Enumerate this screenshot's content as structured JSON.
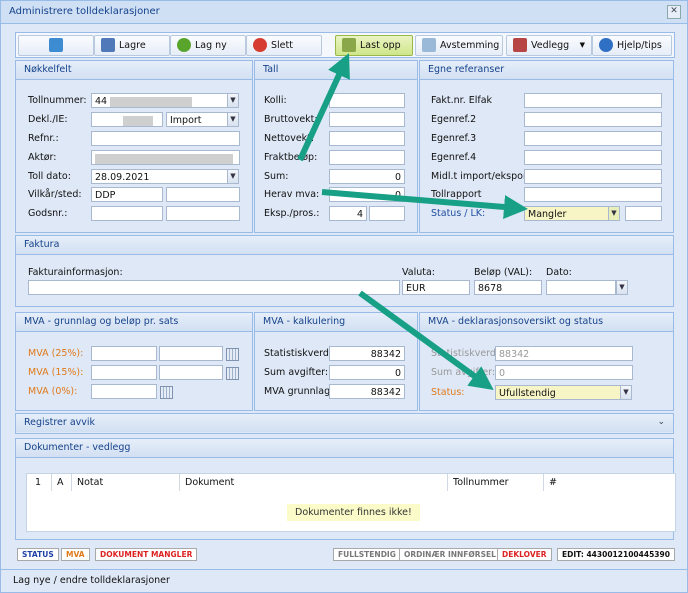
{
  "window": {
    "title": "Administrere tolldeklarasjoner"
  },
  "toolbar": {
    "save": "Lagre",
    "new": "Lag ny",
    "delete": "Slett",
    "upload": "Last opp",
    "reconcile": "Avstemming",
    "attachment": "Vedlegg",
    "help": "Hjelp/tips"
  },
  "nokkelfelt": {
    "title": "Nøkkelfelt",
    "tollnummer_label": "Tollnummer:",
    "tollnummer_value": "44",
    "dekl_label": "Dekl./IE:",
    "dekl_type": "Import",
    "refnr_label": "Refnr.:",
    "aktor_label": "Aktør:",
    "tolldato_label": "Toll dato:",
    "tolldato_value": "28.09.2021",
    "vilkar_label": "Vilkår/sted:",
    "vilkar_value": "DDP",
    "godsnr_label": "Godsnr.:"
  },
  "tall": {
    "title": "Tall",
    "kolli": "Kolli:",
    "brutto": "Bruttovekt:",
    "netto": "Nettovekt:",
    "frakt": "Fraktbeløp:",
    "sum": "Sum:",
    "sum_value": "0",
    "mva": "Herav mva:",
    "mva_value": "0",
    "eksp": "Eksp./pros.:",
    "eksp_value": "4"
  },
  "egne": {
    "title": "Egne referanser",
    "fakt": "Fakt.nr. Elfak",
    "ref2": "Egenref.2",
    "ref3": "Egenref.3",
    "ref4": "Egenref.4",
    "midl": "Midl.t import/eksport",
    "rapport": "Tollrapport",
    "status_label": "Status / LK:",
    "status_value": "Mangler"
  },
  "faktura": {
    "title": "Faktura",
    "info_label": "Fakturainformasjon:",
    "valuta_label": "Valuta:",
    "valuta_value": "EUR",
    "belop_label": "Beløp (VAL):",
    "belop_value": "8678",
    "dato_label": "Dato:"
  },
  "mva_grunnlag": {
    "title": "MVA - grunnlag og beløp pr. sats",
    "r25": "MVA (25%):",
    "r15": "MVA (15%):",
    "r0": "MVA (0%):"
  },
  "mva_kalk": {
    "title": "MVA - kalkulering",
    "stat_label": "Statistiskverdi:",
    "stat_value": "88342",
    "sum_label": "Sum avgifter:",
    "sum_value": "0",
    "grunn_label": "MVA grunnlag:",
    "grunn_value": "88342"
  },
  "mva_dekl": {
    "title": "MVA - deklarasjonsoversikt og status",
    "stat_label": "Statistiskverdi:",
    "stat_value": "88342",
    "sum_label": "Sum avgifter:",
    "sum_value": "0",
    "status_label": "Status:",
    "status_value": "Ufullstendig"
  },
  "avvik": {
    "title": "Registrer avvik"
  },
  "dokumenter": {
    "title": "Dokumenter - vedlegg",
    "columns": [
      "1",
      "A",
      "Notat",
      "Dokument",
      "Tollnummer",
      "#"
    ],
    "empty": "Dokumenter finnes ikke!"
  },
  "badges": {
    "status": "STATUS",
    "mva": "MVA",
    "doc": "DOKUMENT MANGLER",
    "full": "FULLSTENDIG",
    "ordinar": "ORDINÆR INNFØRSEL",
    "deklover": "DEKLOVER",
    "edit": "EDIT: 4430012100445390"
  },
  "statusbar": {
    "text": "Lag nye / endre tolldeklarasjoner"
  },
  "colors": {
    "accent_arrow": "#17a085",
    "orange_label": "#e07a1a",
    "blue_label": "#1f4ea0",
    "highlight": "#f7f5c6"
  }
}
